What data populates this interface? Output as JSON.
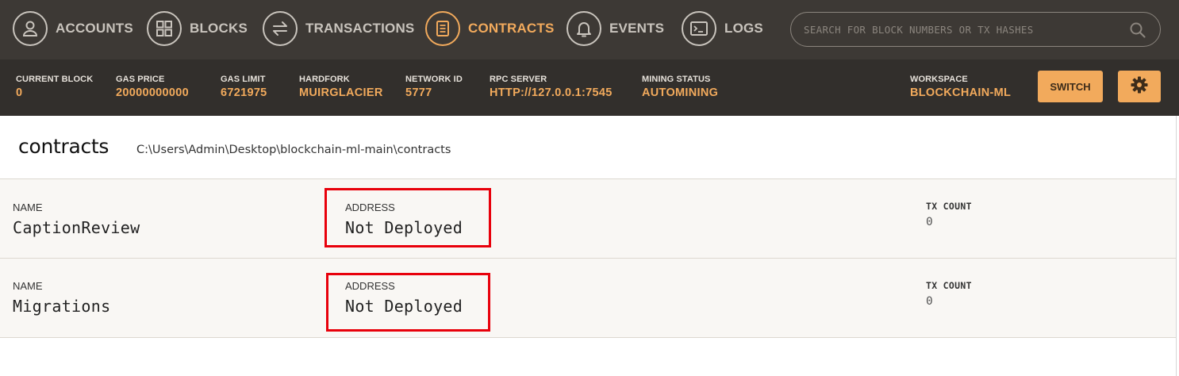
{
  "nav": {
    "items": [
      {
        "label": "ACCOUNTS",
        "icon": "user-icon",
        "active": false
      },
      {
        "label": "BLOCKS",
        "icon": "grid-icon",
        "active": false
      },
      {
        "label": "TRANSACTIONS",
        "icon": "swap-arrows-icon",
        "active": false
      },
      {
        "label": "CONTRACTS",
        "icon": "document-icon",
        "active": true
      },
      {
        "label": "EVENTS",
        "icon": "bell-icon",
        "active": false
      },
      {
        "label": "LOGS",
        "icon": "terminal-icon",
        "active": false
      }
    ],
    "search_placeholder": "SEARCH FOR BLOCK NUMBERS OR TX HASHES"
  },
  "status": {
    "current_block": {
      "label": "CURRENT BLOCK",
      "value": "0"
    },
    "gas_price": {
      "label": "GAS PRICE",
      "value": "20000000000"
    },
    "gas_limit": {
      "label": "GAS LIMIT",
      "value": "6721975"
    },
    "hardfork": {
      "label": "HARDFORK",
      "value": "MUIRGLACIER"
    },
    "network_id": {
      "label": "NETWORK ID",
      "value": "5777"
    },
    "rpc_server": {
      "label": "RPC SERVER",
      "value": "HTTP://127.0.0.1:7545"
    },
    "mining_status": {
      "label": "MINING STATUS",
      "value": "AUTOMINING"
    },
    "workspace": {
      "label": "WORKSPACE",
      "value": "BLOCKCHAIN-ML"
    },
    "switch_label": "SWITCH"
  },
  "page": {
    "title": "contracts",
    "path": "C:\\Users\\Admin\\Desktop\\blockchain-ml-main\\contracts"
  },
  "contracts": [
    {
      "name_label": "NAME",
      "name": "CaptionReview",
      "address_label": "ADDRESS",
      "address": "Not Deployed",
      "tx_label": "TX COUNT",
      "tx_count": "0"
    },
    {
      "name_label": "NAME",
      "name": "Migrations",
      "address_label": "ADDRESS",
      "address": "Not Deployed",
      "tx_label": "TX COUNT",
      "tx_count": "0"
    }
  ],
  "colors": {
    "accent": "#f2aa5c",
    "nav_bg": "#3d3935",
    "status_bg": "#322f2c",
    "highlight": "#e8000b"
  }
}
